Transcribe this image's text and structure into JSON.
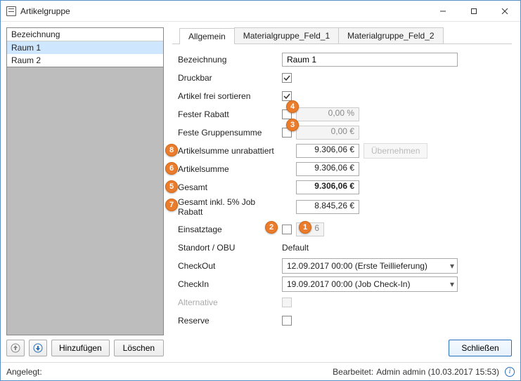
{
  "window": {
    "title": "Artikelgruppe"
  },
  "sidebar": {
    "header": "Bezeichnung",
    "items": [
      "Raum 1",
      "Raum 2"
    ],
    "selected_index": 0,
    "add_label": "Hinzufügen",
    "delete_label": "Löschen"
  },
  "tabs": {
    "items": [
      "Allgemein",
      "Materialgruppe_Feld_1",
      "Materialgruppe_Feld_2"
    ],
    "active_index": 0
  },
  "form": {
    "bezeichnung_label": "Bezeichnung",
    "bezeichnung_value": "Raum 1",
    "druckbar_label": "Druckbar",
    "druckbar_checked": true,
    "artikel_frei_label": "Artikel frei sortieren",
    "artikel_frei_checked": true,
    "fester_rabatt_label": "Fester Rabatt",
    "fester_rabatt_checked": false,
    "fester_rabatt_value": "0,00 %",
    "feste_summe_label": "Feste Gruppensumme",
    "feste_summe_checked": false,
    "feste_summe_value": "0,00 €",
    "artikelsumme_unrab_label": "Artikelsumme unrabattiert",
    "artikelsumme_unrab_value": "9.306,06 €",
    "uebernehmen_label": "Übernehmen",
    "artikelsumme_label": "Artikelsumme",
    "artikelsumme_value": "9.306,06 €",
    "gesamt_label": "Gesamt",
    "gesamt_value": "9.306,06 €",
    "gesamt_rabatt_label": "Gesamt inkl. 5% Job Rabatt",
    "gesamt_rabatt_value": "8.845,26 €",
    "einsatztage_label": "Einsatztage",
    "einsatztage_checked": false,
    "einsatztage_value": "6",
    "standort_label": "Standort / OBU",
    "standort_value": "Default",
    "checkout_label": "CheckOut",
    "checkout_value": "12.09.2017 00:00 (Erste Teillieferung)",
    "checkin_label": "CheckIn",
    "checkin_value": "19.09.2017 00:00 (Job Check-In)",
    "alternative_label": "Alternative",
    "reserve_label": "Reserve",
    "reserve_checked": false
  },
  "annotations": {
    "b1": "1",
    "b2": "2",
    "b3": "3",
    "b4": "4",
    "b5": "5",
    "b6": "6",
    "b7": "7",
    "b8": "8"
  },
  "footer": {
    "close_label": "Schließen",
    "angelegt_label": "Angelegt:",
    "bearbeitet_label": "Bearbeitet:",
    "bearbeitet_value": "Admin admin (10.03.2017 15:53)"
  }
}
